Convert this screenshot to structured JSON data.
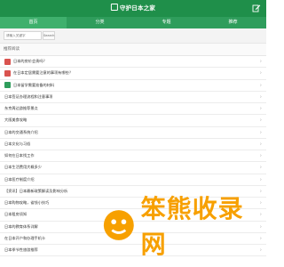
{
  "header": {
    "logo_text": "守护日本之家"
  },
  "nav": [
    {
      "label": "首页"
    },
    {
      "label": "分类"
    },
    {
      "label": "专题"
    },
    {
      "label": "推荐"
    }
  ],
  "search": {
    "placeholder": "请输入关键字",
    "button_label": "Search"
  },
  "section": {
    "title": "推荐阅读"
  },
  "list": [
    {
      "text": "日本的房价会贵吗？",
      "thumb": "red"
    },
    {
      "text": "在日本定居需要注意的事项有哪些？",
      "thumb": "red"
    },
    {
      "text": "日本留学需要准备的材料",
      "thumb": "green"
    },
    {
      "text": "日本签证办理流程和注意事项",
      "thumb": "none"
    },
    {
      "text": "东京周边游推荐景点",
      "thumb": "none"
    },
    {
      "text": "大阪美食攻略",
      "thumb": "none"
    },
    {
      "text": "日本的交通系统介绍",
      "thumb": "none"
    },
    {
      "text": "日本文化与习俗",
      "thumb": "none"
    },
    {
      "text": "如何在日本找工作",
      "thumb": "none"
    },
    {
      "text": "日本生活费用大概多少",
      "thumb": "none"
    },
    {
      "text": "日本医疗制度介绍",
      "thumb": "none"
    },
    {
      "text": "【资讯】日本最新政策解读及影响分析",
      "thumb": "none"
    },
    {
      "text": "日本购物攻略，省钱小技巧",
      "thumb": "none"
    },
    {
      "text": "日本租房须知",
      "thumb": "none"
    },
    {
      "text": "日本的教育体系详解",
      "thumb": "none"
    },
    {
      "text": "在日本开户和办理手机卡",
      "thumb": "none"
    },
    {
      "text": "日本季节性旅游推荐",
      "thumb": "none"
    }
  ],
  "watermark": {
    "text": "笨熊收录网"
  }
}
